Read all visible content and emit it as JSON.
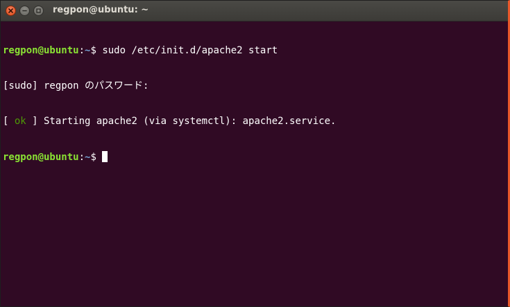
{
  "window": {
    "title": "regpon@ubuntu: ~"
  },
  "terminal": {
    "lines": [
      {
        "user_host": "regpon@ubuntu",
        "sep": ":",
        "path": "~",
        "symbol": "$",
        "command": " sudo /etc/init.d/apache2 start"
      },
      {
        "text": "[sudo] regpon のパスワード:"
      },
      {
        "bracket_open": "[ ",
        "status": "ok",
        "bracket_close": " ]",
        "message": " Starting apache2 (via systemctl): apache2.service."
      },
      {
        "user_host": "regpon@ubuntu",
        "sep": ":",
        "path": "~",
        "symbol": "$",
        "command": " "
      }
    ]
  },
  "colors": {
    "background": "#300a24",
    "user_host": "#8ae234",
    "path": "#729fcf",
    "ok": "#4e9a06",
    "close_button": "#df4a16"
  },
  "icons": {
    "close": "close-icon",
    "minimize": "minimize-icon",
    "maximize": "maximize-icon"
  }
}
